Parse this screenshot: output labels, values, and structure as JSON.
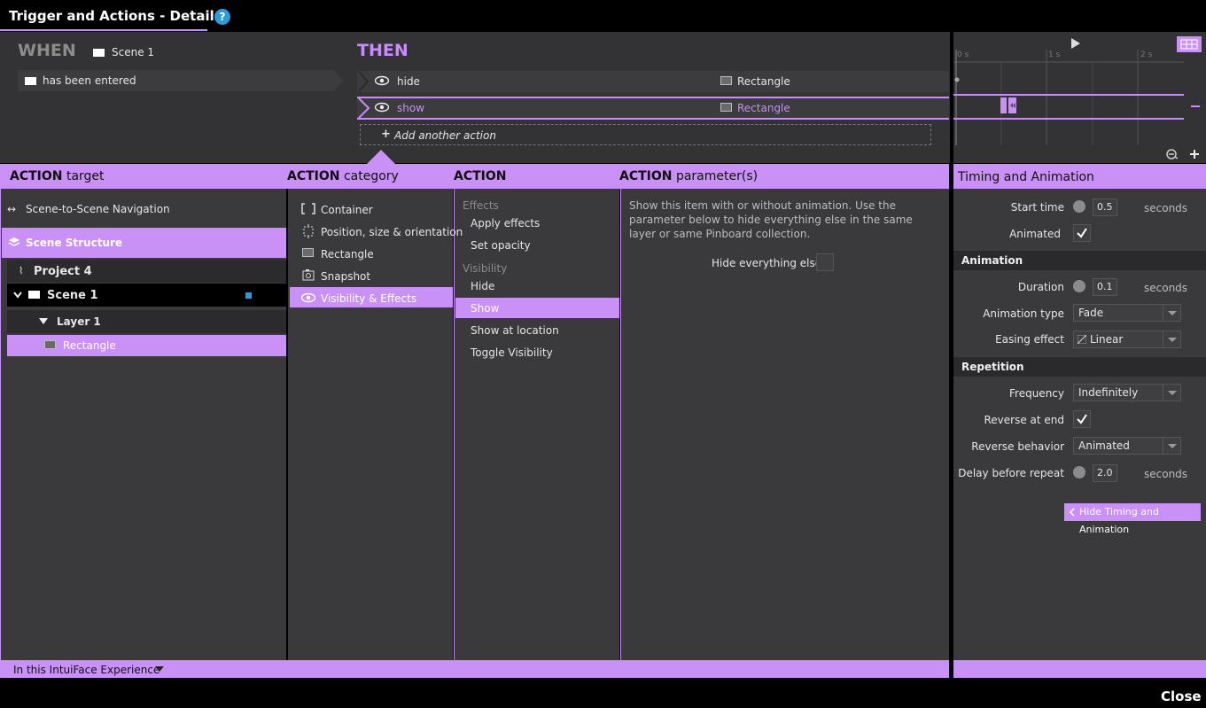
{
  "window": {
    "title": "Trigger and Actions - Details",
    "help": "?",
    "close_label": "Close"
  },
  "when": {
    "label": "WHEN",
    "scene": "Scene 1",
    "trigger": "has been entered"
  },
  "then": {
    "label": "THEN",
    "actions": [
      {
        "verb": "hide",
        "target": "Rectangle"
      },
      {
        "verb": "show",
        "target": "Rectangle"
      }
    ],
    "add_label": "Add another action"
  },
  "timeline": {
    "ticks": [
      "0 s",
      "1 s",
      "2 s"
    ]
  },
  "headers": {
    "target": {
      "strong": "ACTION",
      "rest": "target"
    },
    "category": {
      "strong": "ACTION",
      "rest": "category"
    },
    "action": {
      "strong": "ACTION",
      "rest": ""
    },
    "params": {
      "strong": "ACTION",
      "rest": "parameter(s)"
    },
    "timing": "Timing and Animation"
  },
  "target_panel": {
    "nav": "Scene-to-Scene Navigation",
    "structure": "Scene Structure",
    "project": "Project 4",
    "scene": "Scene 1",
    "layer": "Layer 1",
    "item": "Rectangle",
    "footer": "In this IntuiFace Experience"
  },
  "category_panel": {
    "items": [
      "Container",
      "Position, size & orientation",
      "Rectangle",
      "Snapshot",
      "Visibility & Effects"
    ]
  },
  "action_panel": {
    "effects_label": "Effects",
    "effects": [
      "Apply effects",
      "Set opacity"
    ],
    "visibility_label": "Visibility",
    "visibility": [
      "Hide",
      "Show",
      "Show at location",
      "Toggle Visibility"
    ]
  },
  "params_panel": {
    "description": "Show this item with or without animation. Use the parameter below to hide everything else in the same layer or same Pinboard collection.",
    "hide_else_label": "Hide everything else"
  },
  "timing": {
    "start_time_label": "Start time",
    "start_time": "0.5",
    "seconds": "seconds",
    "animated_label": "Animated",
    "animation_section": "Animation",
    "duration_label": "Duration",
    "duration": "0.1",
    "animation_type_label": "Animation type",
    "animation_type": "Fade",
    "easing_label": "Easing effect",
    "easing": "Linear",
    "repetition_section": "Repetition",
    "frequency_label": "Frequency",
    "frequency": "Indefinitely",
    "reverse_label": "Reverse at end",
    "reverse_behavior_label": "Reverse behavior",
    "reverse_behavior": "Animated",
    "delay_label": "Delay before repeat",
    "delay": "2.0",
    "hide_button": "Hide Timing and Animation"
  },
  "colors": {
    "accent": "#c990f5",
    "panel": "#3a3a3c",
    "help": "#2e9bd6"
  }
}
